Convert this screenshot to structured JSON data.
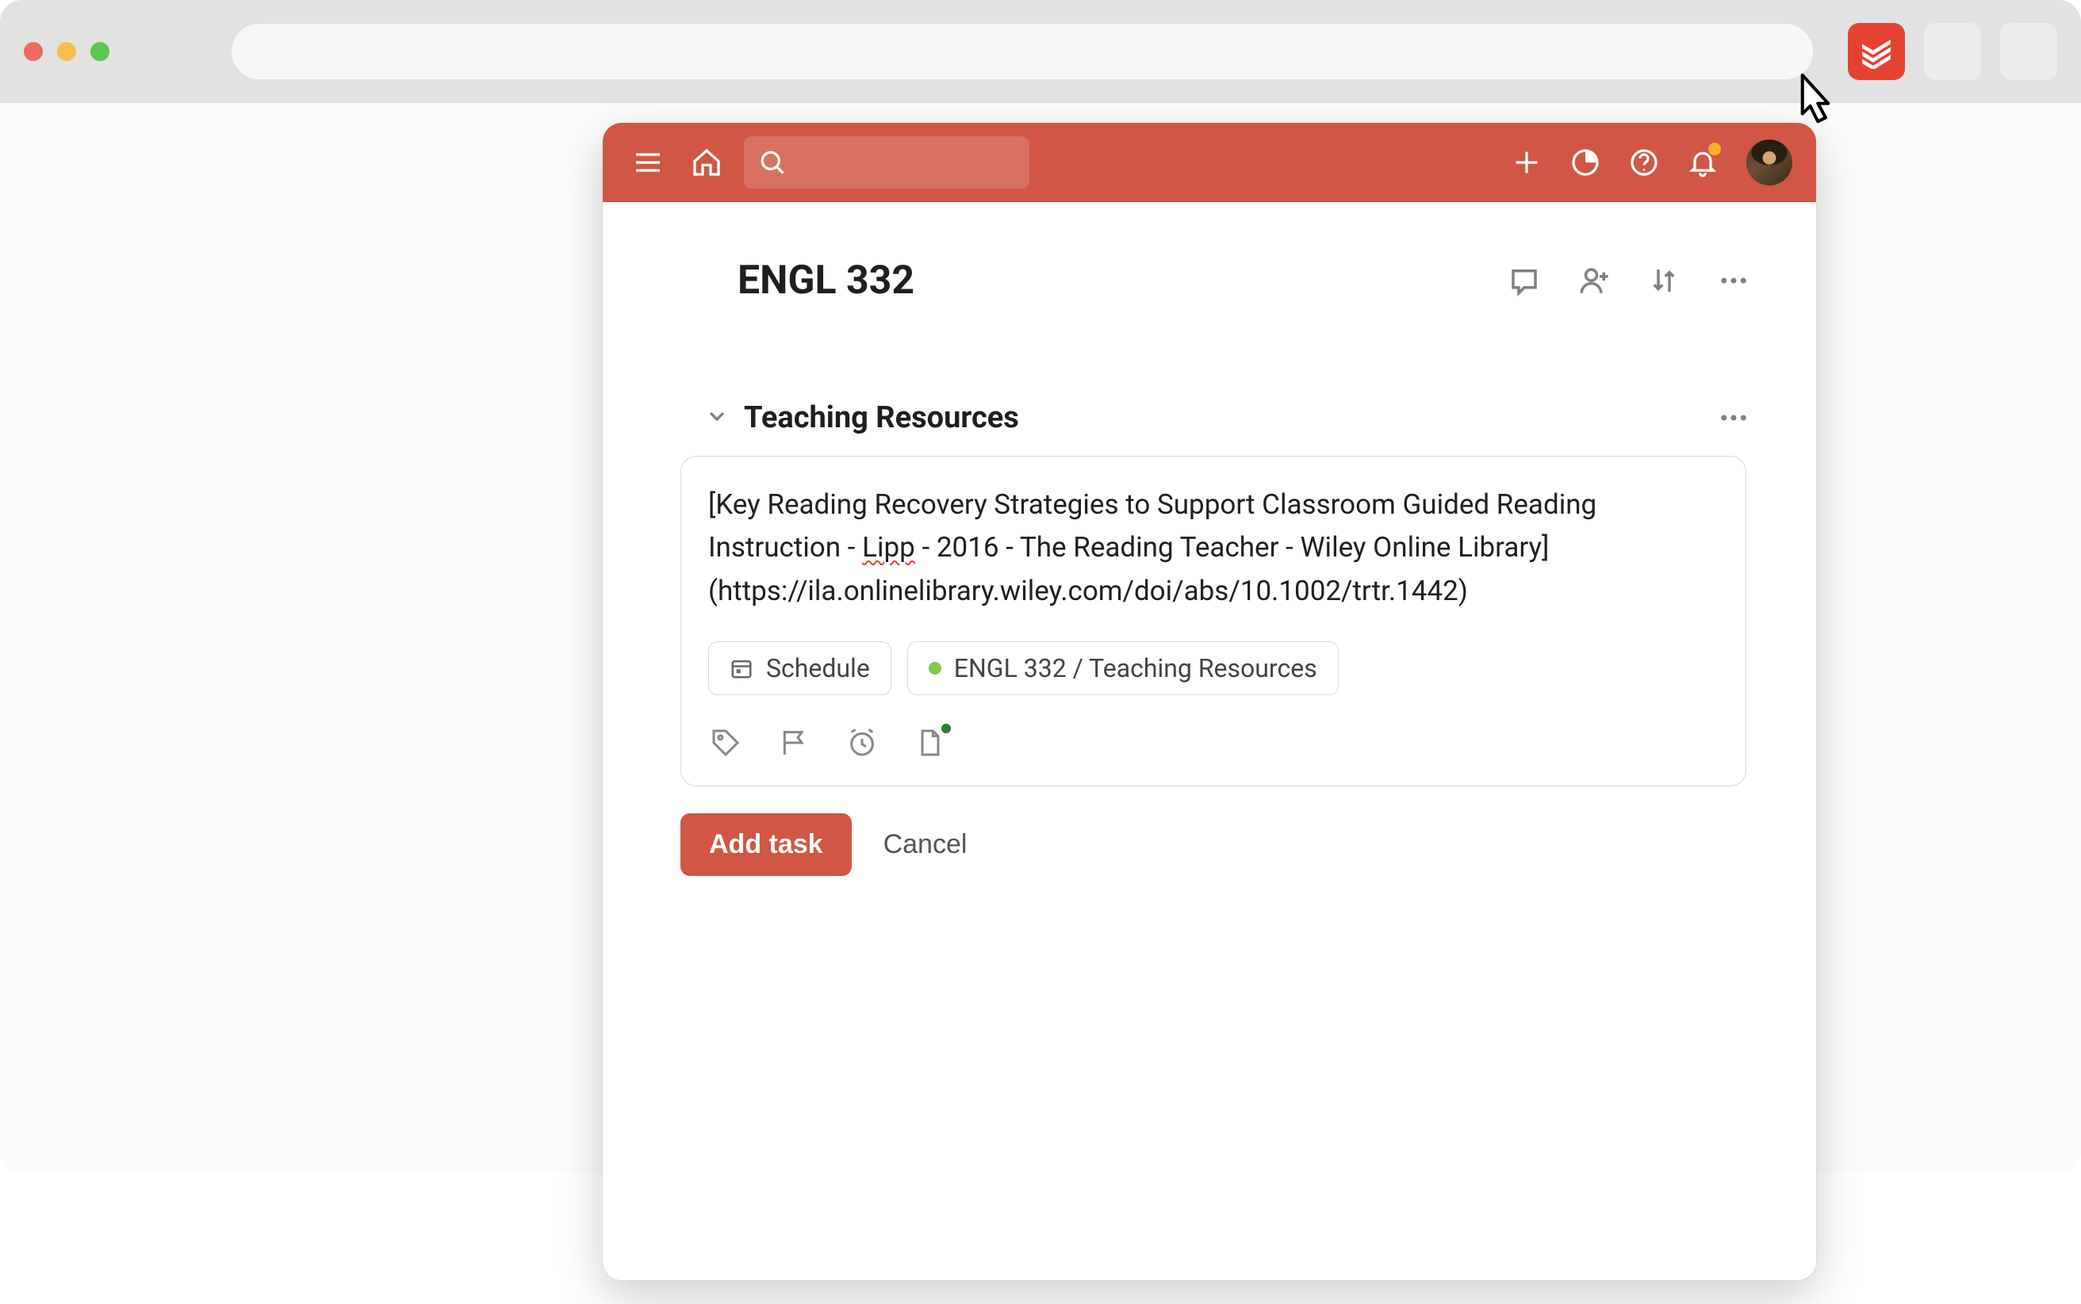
{
  "browser": {
    "address_value": ""
  },
  "popup": {
    "project_title": "ENGL 332",
    "section_title": "Teaching Resources",
    "task_editor": {
      "content_prefix": "[Key Reading Recovery Strategies to Support Classroom Guided Reading Instruction - ",
      "content_spellword": "Lipp",
      "content_suffix": " - 2016 - The Reading Teacher - Wiley Online Library](https://ila.onlinelibrary.wiley.com/doi/abs/10.1002/trtr.1442)",
      "schedule_chip": "Schedule",
      "project_chip": "ENGL 332 / Teaching Resources"
    },
    "buttons": {
      "add_task": "Add task",
      "cancel": "Cancel"
    }
  }
}
